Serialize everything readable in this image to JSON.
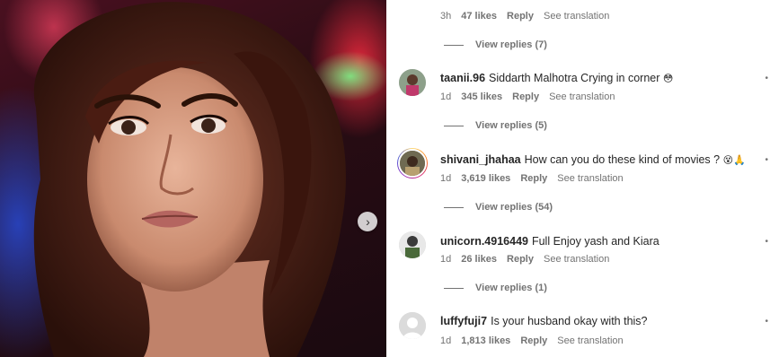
{
  "post": {
    "image_icon": "portrait-photo",
    "next_icon": "chevron-right-icon"
  },
  "top_meta": {
    "time": "3h",
    "likes": "47 likes",
    "reply": "Reply",
    "translate": "See translation"
  },
  "view_replies": [
    "View replies (7)",
    "View replies (5)",
    "View replies (54)",
    "View replies (1)"
  ],
  "comments": [
    {
      "username": "taanii.96",
      "text": "Siddarth Malhotra Crying in corner",
      "emoji": "😳",
      "time": "1d",
      "likes": "345 likes",
      "reply": "Reply",
      "translate": "See translation"
    },
    {
      "username": "shivani_jhahaa",
      "text": "How can you do these kind of movies ?",
      "emoji": "😵🙏",
      "time": "1d",
      "likes": "3,619 likes",
      "reply": "Reply",
      "translate": "See translation"
    },
    {
      "username": "unicorn.4916449",
      "text": "Full Enjoy yash and Kiara",
      "emoji": "",
      "time": "1d",
      "likes": "26 likes",
      "reply": "Reply",
      "translate": "See translation"
    },
    {
      "username": "luffyfuji7",
      "text": "Is your husband okay with this?",
      "emoji": "",
      "time": "1d",
      "likes": "1,813 likes",
      "reply": "Reply",
      "translate": "See translation"
    }
  ],
  "colors": {
    "secondary_text": "#737373",
    "primary_text": "#262626",
    "story_ring": "#d62976"
  }
}
